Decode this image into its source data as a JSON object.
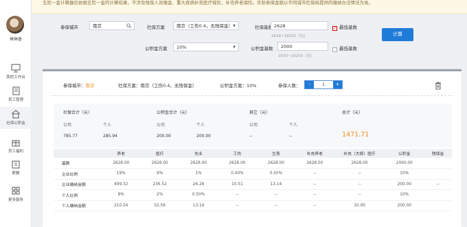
{
  "notice": {
    "text": "五险一金计算器仅依据五险一金的计算结果，不涉及残保人员缴金、重大疾病补充医疗保险、补充养老保险。实际参保金额以不同城市社保局提供的缴纳办法情况为准。"
  },
  "sidebar": {
    "user_name": "琳琳香",
    "items": [
      {
        "label": "我的工作台",
        "icon": "monitor-icon"
      },
      {
        "label": "员工管理",
        "icon": "document-icon"
      },
      {
        "label": "社保公积金",
        "icon": "home-icon"
      },
      {
        "label": "员工福利",
        "icon": "gift-icon"
      },
      {
        "label": "薪酬",
        "icon": "wallet-icon"
      },
      {
        "label": "更多服务",
        "icon": "grid-icon"
      }
    ]
  },
  "form": {
    "city_label": "参保城市",
    "city_value": "南京",
    "social_plan_label": "社保方案",
    "social_plan_value": "南京（工伤0.4，无残保金）",
    "social_base_label": "社保基数",
    "social_base_value": "2628",
    "social_base_hint": "2628~18200（元）",
    "social_min_label": "最低基数",
    "social_min_checked": true,
    "fund_plan_label": "公积金方案",
    "fund_plan_value": "10%",
    "fund_base_label": "公积金基数",
    "fund_base_value": "2000",
    "fund_base_hint": "1630~18200（元）",
    "fund_min_label": "最低基数",
    "fund_min_checked": false,
    "calc_label": "计算"
  },
  "summary": {
    "city_text": "参保城市：",
    "city_value": "南京",
    "social_plan_text": "社保方案：南京（工伤0.4，无残保金）",
    "fund_plan_text": "公积金方案：10%",
    "people_label": "参保人数：",
    "minus": "-",
    "people_count": "1",
    "plus": "+"
  },
  "totals": {
    "social_total_label": "社保合计（元）",
    "fund_total_label": "公积金合计（元）",
    "other_label": "其它（元）",
    "grand_label": "总计（元）",
    "company": "公司",
    "personal": "个人",
    "social_company": "785.77",
    "social_personal": "285.94",
    "fund_company": "200.00",
    "fund_personal": "200.00",
    "other_company": "--",
    "other_personal": "--",
    "grand_total": "1471.71"
  },
  "table": {
    "headers": [
      "",
      "养老",
      "医疗",
      "失业",
      "工伤",
      "生育",
      "补充养老",
      "补充（大病）医疗",
      "公积金",
      "残保金"
    ],
    "rows": [
      [
        "基数",
        "2628.00",
        "2628.00",
        "2628.00",
        "2628.00",
        "2628.00",
        "2628.00",
        "2628.00",
        "2000.00",
        ""
      ],
      [
        "企业比例",
        "19%",
        "9%",
        "1%",
        "0.40%",
        "0.50%",
        "--",
        "--",
        "10%",
        ""
      ],
      [
        "企业缴纳金额",
        "499.32",
        "236.52",
        "26.28",
        "10.51",
        "13.14",
        "--",
        "--",
        "200.00",
        "--"
      ],
      [
        "个人比例",
        "8%",
        "2%",
        "0.50%",
        "--",
        "--",
        "--",
        "--",
        "10%",
        ""
      ],
      [
        "个人缴纳金额",
        "210.24",
        "52.56",
        "13.14",
        "--",
        "--",
        "--",
        "10.00",
        "200.00",
        ""
      ]
    ]
  },
  "colors": {
    "accent": "#1f7bd8",
    "total": "#f08c1c",
    "notice_bg": "#fdf8e6"
  }
}
